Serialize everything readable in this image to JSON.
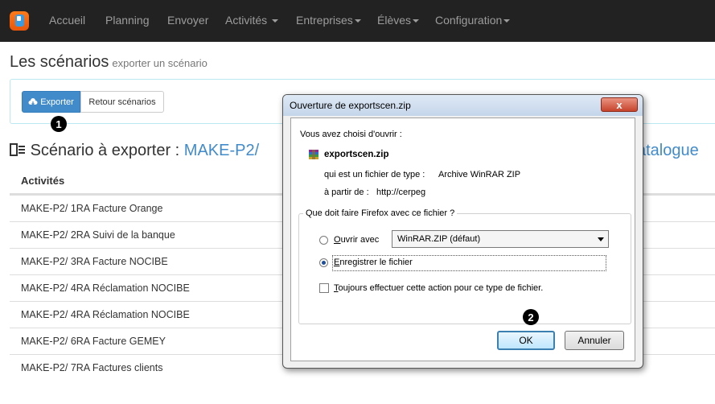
{
  "nav": {
    "items": [
      {
        "label": "Accueil",
        "caret": false
      },
      {
        "label": "Planning",
        "caret": false
      },
      {
        "label": "Envoyer",
        "caret": false
      },
      {
        "label": "Activités",
        "caret": true
      },
      {
        "label": "Entreprises",
        "caret": true
      },
      {
        "label": "Élèves",
        "caret": true
      },
      {
        "label": "Configuration",
        "caret": true
      }
    ]
  },
  "page": {
    "title": "Les scénarios",
    "subtitle": "exporter un scénario",
    "export_label": "Exporter",
    "back_label": "Retour scénarios",
    "badge1": "1",
    "badge2": "2",
    "heading_prefix": "Scénario à exporter :",
    "heading_link": "MAKE-P2/",
    "heading_right": "atalogue"
  },
  "table": {
    "header": "Activités",
    "rows": [
      "MAKE-P2/ 1RA Facture Orange",
      "MAKE-P2/ 2RA Suivi de la banque",
      "MAKE-P2/ 3RA Facture NOCIBE",
      "MAKE-P2/ 4RA Réclamation NOCIBE",
      "MAKE-P2/ 4RA Réclamation NOCIBE",
      "MAKE-P2/ 6RA Facture GEMEY",
      "MAKE-P2/ 7RA Factures clients"
    ]
  },
  "dialog": {
    "title": "Ouverture de exportscen.zip",
    "close": "x",
    "intro": "Vous avez choisi d'ouvrir :",
    "filename": "exportscen.zip",
    "type_label": "qui est un fichier de type :",
    "type_value": "Archive WinRAR ZIP",
    "from_label": "à partir de :",
    "from_value": "http://cerpeg",
    "question": "Que doit faire Firefox avec ce fichier ?",
    "open_with_first": "O",
    "open_with_rest": "uvrir avec",
    "app_select": "WinRAR.ZIP (défaut)",
    "save_first": "E",
    "save_rest": "nregistrer le fichier",
    "always_first": "T",
    "always_rest": "oujours effectuer cette action pour ce type de fichier.",
    "ok": "OK",
    "cancel": "Annuler",
    "selected_option": "save"
  }
}
